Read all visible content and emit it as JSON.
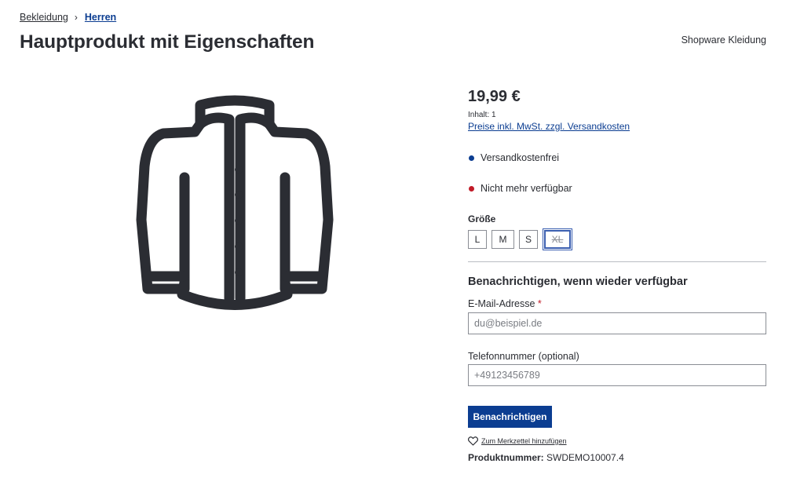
{
  "breadcrumb": {
    "items": [
      "Bekleidung",
      "Herren"
    ],
    "separator": "›"
  },
  "page": {
    "title": "Hauptprodukt mit Eigenschaften",
    "manufacturer": "Shopware Kleidung"
  },
  "buybox": {
    "price": "19,99 €",
    "content": "Inhalt: 1",
    "tax_link": "Preise inkl. MwSt. zzgl. Versandkosten",
    "shipping": "Versandkostenfrei",
    "availability": "Nicht mehr verfügbar",
    "shipping_color": "#0b3d91",
    "availability_color": "#c11b28"
  },
  "size": {
    "label": "Größe",
    "options": [
      "L",
      "M",
      "S",
      "XL"
    ],
    "unavailable": "XL"
  },
  "notify": {
    "title": "Benachrichtigen, wenn wieder verfügbar",
    "email_label": "E-Mail-Adresse",
    "email_required": "*",
    "email_placeholder": "du@beispiel.de",
    "phone_label": "Telefonnummer (optional)",
    "phone_placeholder": "+49123456789",
    "button": "Benachrichtigen"
  },
  "wishlist": {
    "label": "Zum Merkzettel hinzufügen",
    "icon": "heart-icon"
  },
  "product_number": {
    "label": "Produktnummer:",
    "value": "SWDEMO10007.4"
  },
  "colors": {
    "accent": "#0b3d91",
    "text": "#2b2d33",
    "error": "#c11b28"
  }
}
